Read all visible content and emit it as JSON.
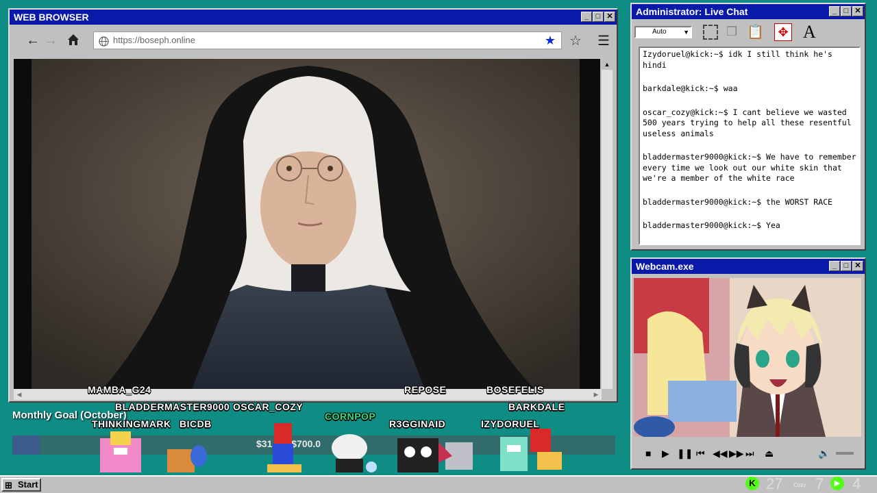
{
  "browser": {
    "title": "WEB BROWSER",
    "url": "https://boseph.online"
  },
  "chat": {
    "title": "Administrator: Live Chat",
    "font_size_select": "Auto",
    "messages": [
      {
        "user": "Izydoruel@kick:~$",
        "text": "idk I still think he's hindi"
      },
      {
        "user": "barkdale@kick:~$",
        "text": "waa"
      },
      {
        "user": "oscar_cozy@kick:~$",
        "text": "I cant believe we wasted 500 years trying to help all these resentful useless animals"
      },
      {
        "user": "bladdermaster9000@kick:~$",
        "text": "We have to remember every time we look out our white skin that we're a member of the white race"
      },
      {
        "user": "bladdermaster9000@kick:~$",
        "text": "the WORST RACE"
      },
      {
        "user": "bladdermaster9000@kick:~$",
        "text": "Yea"
      }
    ]
  },
  "webcam": {
    "title": "Webcam.exe"
  },
  "goal": {
    "label": "Monthly Goal (October)",
    "amount_text": "$31",
    "amount_total": "/$700.0",
    "amount_tail": ")",
    "progress": 0.045
  },
  "overlay_names": {
    "mamba": "MAMBA_G24",
    "repose": "REPOSE",
    "bosefelis": "BOSEFELIS",
    "bladdermaster": "BLADDERMASTER9000",
    "oscar": "OSCAR_COZY",
    "barkdale": "BARKDALE",
    "cornpop": "CORNPOP",
    "thinkingmark": "THINKINGMARK",
    "bicdb": "BICDB",
    "r3gginaid": "R3GGINAID",
    "izydoruel": "IZYDORUEL"
  },
  "taskbar": {
    "start": "Start",
    "viewers": "27",
    "cozy": "Cozy",
    "cozy_count": "7",
    "other_count": "4"
  },
  "colors": {
    "desktop": "#0f8c84",
    "titlebar": "#0a1aa8",
    "kick_green": "#53fc18",
    "cornpop_green": "#3ddc84",
    "progress_fill": "#3c5a8c"
  }
}
